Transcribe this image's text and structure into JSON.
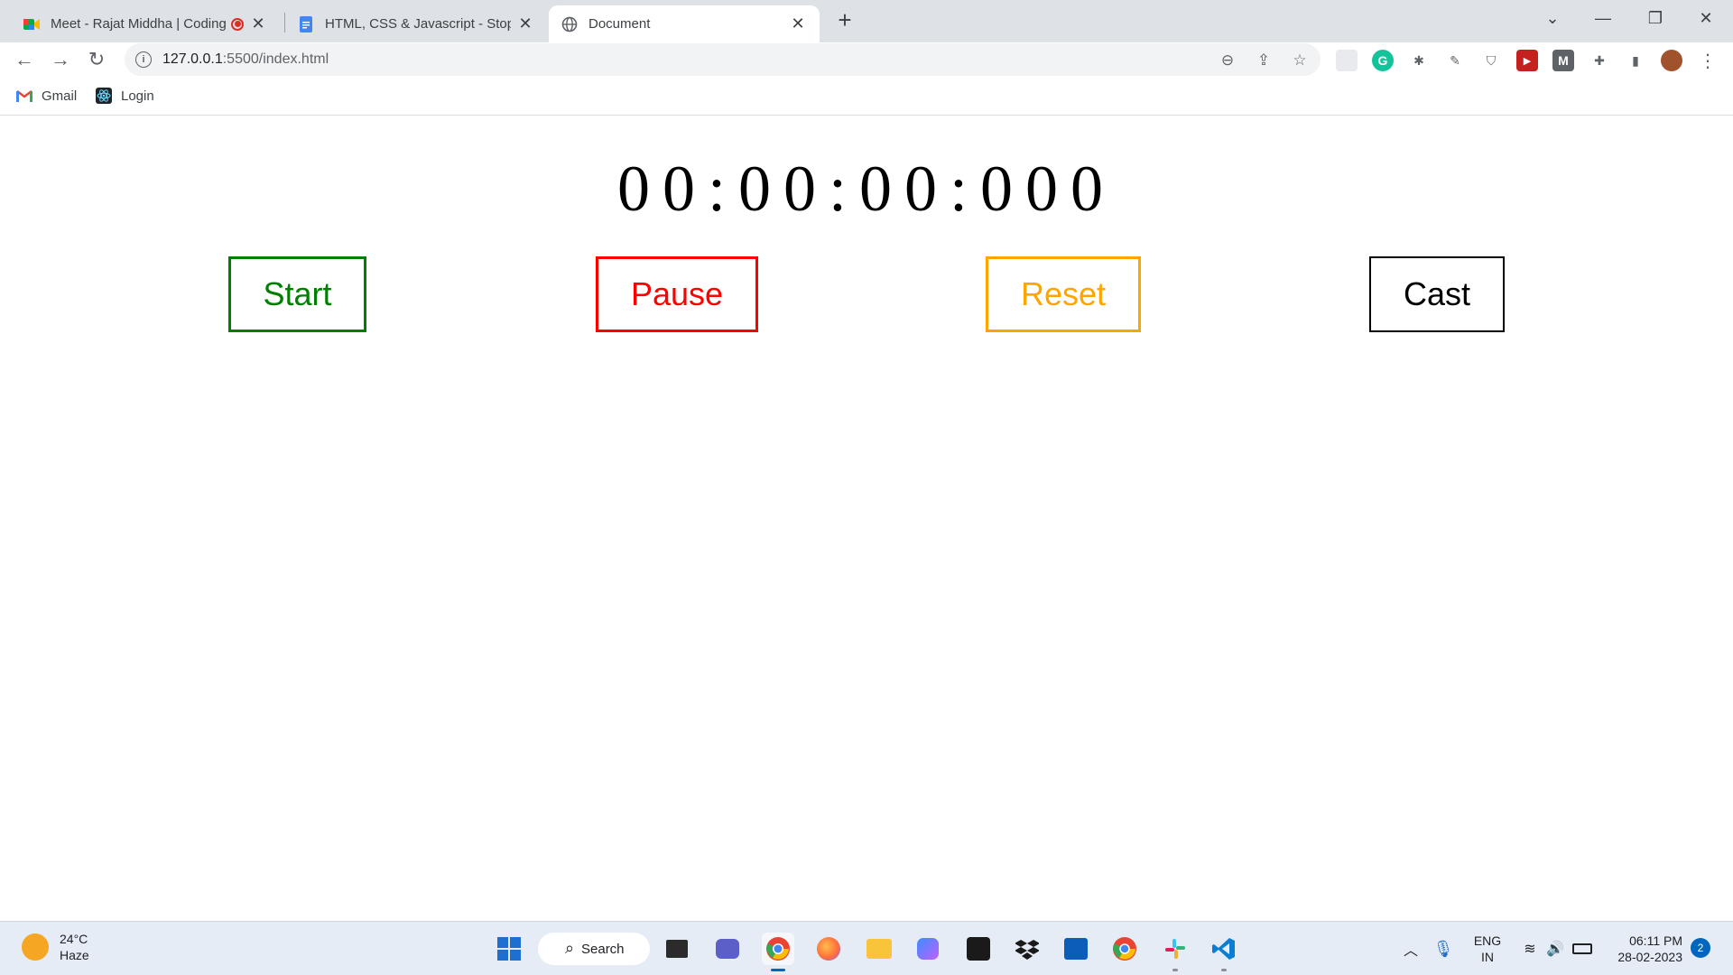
{
  "browser": {
    "tabs": [
      {
        "title": "Meet - Rajat Middha | Coding",
        "icon": "google-meet-icon"
      },
      {
        "title": "HTML, CSS & Javascript - Stopwatch",
        "icon": "google-docs-icon"
      },
      {
        "title": "Document",
        "icon": "globe-icon",
        "active": true
      }
    ],
    "address": {
      "host": "127.0.0.1",
      "path": ":5500/index.html"
    },
    "bookmarks": [
      {
        "label": "Gmail",
        "icon": "gmail-icon"
      },
      {
        "label": "Login",
        "icon": "react-icon"
      }
    ]
  },
  "stopwatch": {
    "display": "00:00:00:000",
    "buttons": [
      {
        "label": "Start",
        "color": "#008000"
      },
      {
        "label": "Pause",
        "color": "#ff0000"
      },
      {
        "label": "Reset",
        "color": "#ffa500"
      },
      {
        "label": "Cast",
        "color": "#000000"
      }
    ]
  },
  "taskbar": {
    "weather": {
      "temp": "24°C",
      "condition": "Haze"
    },
    "search_label": "Search",
    "language": {
      "line1": "ENG",
      "line2": "IN"
    },
    "clock": {
      "time": "06:11 PM",
      "date": "28-02-2023"
    },
    "notifications": "2"
  }
}
